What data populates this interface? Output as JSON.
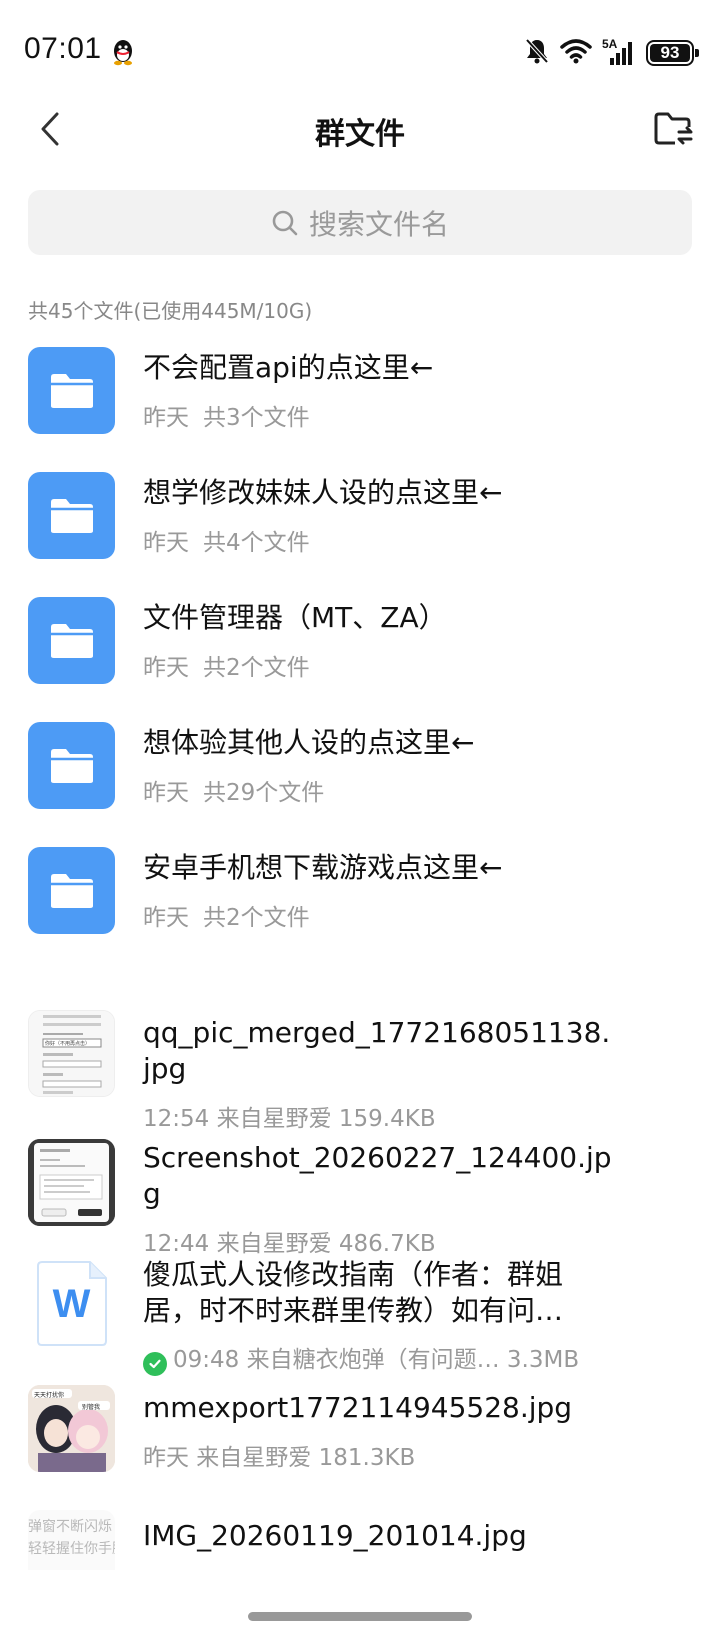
{
  "status": {
    "time": "07:01",
    "network": "5A",
    "battery": "93"
  },
  "header": {
    "title": "群文件"
  },
  "search": {
    "placeholder": "搜索文件名"
  },
  "summary": "共45个文件(已使用445M/10G)",
  "folders": [
    {
      "name": "不会配置api的点这里←",
      "date": "昨天",
      "count": "共3个文件"
    },
    {
      "name": "想学修改妹妹人设的点这里←",
      "date": "昨天",
      "count": "共4个文件"
    },
    {
      "name": "文件管理器（MT、ZA）",
      "date": "昨天",
      "count": "共2个文件"
    },
    {
      "name": "想体验其他人设的点这里←",
      "date": "昨天",
      "count": "共29个文件"
    },
    {
      "name": "安卓手机想下载游戏点这里←",
      "date": "昨天",
      "count": "共2个文件"
    }
  ],
  "files": [
    {
      "name": "qq_pic_merged_1772168051138.jpg",
      "meta": "12:54 来自星野爱 159.4KB",
      "kind": "image"
    },
    {
      "name": "Screenshot_20260227_124400.jpg",
      "meta": "12:44 来自星野爱 486.7KB",
      "kind": "image"
    },
    {
      "name": "傻瓜式人设修改指南（作者：群姐居，时不时来群里传教）如有问…",
      "meta": "09:48 来自糖衣炮弹（有问题… 3.3MB",
      "kind": "word",
      "thumb_letter": "W"
    },
    {
      "name": "mmexport1772114945528.jpg",
      "meta": "昨天 来自星野爱 181.3KB",
      "kind": "image"
    },
    {
      "name": "IMG_20260119_201014.jpg",
      "meta": "",
      "kind": "image"
    }
  ],
  "thumb_text": {
    "file1": "你好（不用再点击）",
    "file4_a": "天天打扰你",
    "file4_b": "别管我",
    "file5_a": "弹窗不断闪烁",
    "file5_b": "轻轻握住你手腕"
  },
  "colors": {
    "folder_blue": "#4d9bf5",
    "word_blue": "#3d8ef0",
    "check_green": "#2fbf5a"
  }
}
